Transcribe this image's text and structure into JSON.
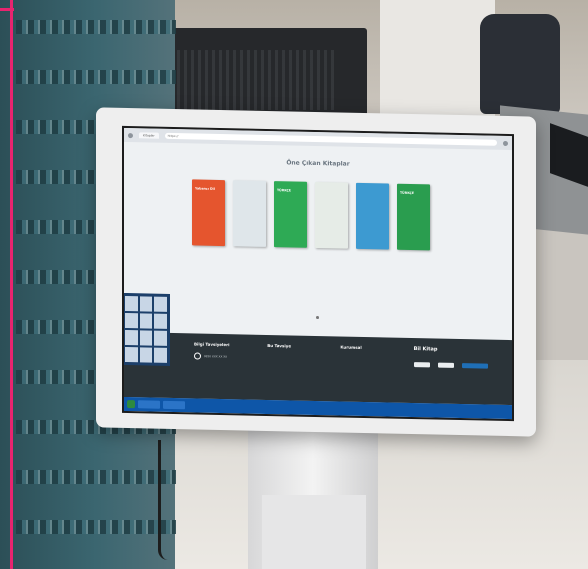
{
  "browser": {
    "tab_label": "Kitaplar",
    "url": "https://"
  },
  "page": {
    "section_title": "Öne Çıkan Kitaplar"
  },
  "books": [
    {
      "cover_title": "Yabancı Dil",
      "caption": "",
      "color": "#e5552e"
    },
    {
      "cover_title": "",
      "caption": "",
      "color": "#dfe6ea"
    },
    {
      "cover_title": "TÜRKÇE",
      "caption": "",
      "color": "#2eaa55"
    },
    {
      "cover_title": "",
      "caption": "",
      "color": "#e6ece7"
    },
    {
      "cover_title": "",
      "caption": "",
      "color": "#3d9ad1"
    },
    {
      "cover_title": "TÜRKÇE",
      "caption": "",
      "color": "#2a9d4f"
    }
  ],
  "footer": {
    "col1_title": "Bilgi Tavsiyeleri",
    "col1_lines": "0850 XXX XX XX",
    "col2_title": "Bu Tavsiye",
    "col2_lines": "",
    "col3_title": "Kurumsal",
    "col3_lines": "",
    "logo_text": "Bil Kitap"
  },
  "keypad": {
    "keys": [
      "",
      "",
      "",
      "",
      "",
      "",
      "",
      "",
      "",
      "",
      "",
      ""
    ]
  },
  "taskbar": {
    "clock": ""
  },
  "colors": {
    "accent": "#e8246f",
    "footer_bg": "#2a3338",
    "taskbar": "#0e56a8"
  }
}
